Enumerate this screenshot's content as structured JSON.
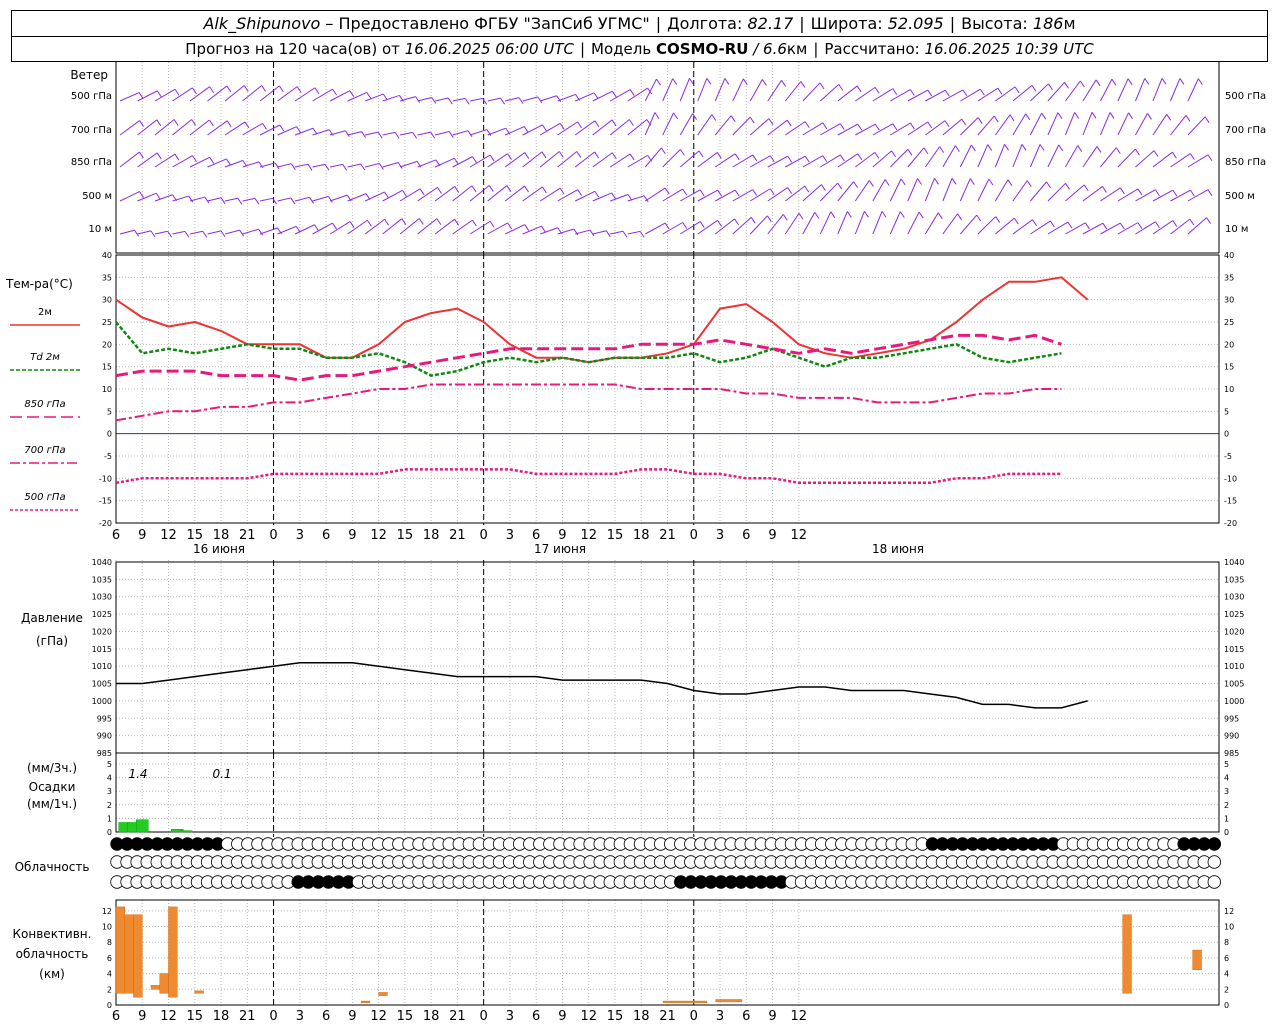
{
  "header": {
    "station": "Alk_Shipunovo",
    "provider": "– Предоставлено ФГБУ \"ЗапСиб УГМС\"",
    "lon_label": "Долгота:",
    "lon_value": "82.17",
    "lat_label": "Широта:",
    "lat_value": "52.095",
    "alt_label": "Высота:",
    "alt_value": "186",
    "alt_unit": "м",
    "forecast_label": "Прогноз на 120 часа(ов) от",
    "forecast_start": "16.06.2025 06:00 UTC",
    "model_label": "Модель",
    "model_name": "COSMO-RU",
    "model_res": "/ 6.6",
    "model_res_unit": "км",
    "calc_label": "Рассчитано:",
    "calc_time": "16.06.2025 10:39 UTC"
  },
  "time_axis": {
    "hour_ticks": [
      "6",
      "9",
      "12",
      "15",
      "18",
      "21",
      "0",
      "3",
      "6",
      "9",
      "12",
      "15",
      "18",
      "21",
      "0",
      "3",
      "6",
      "9",
      "12",
      "15",
      "18",
      "21",
      "0",
      "3",
      "6",
      "9",
      "12"
    ],
    "day_labels": [
      "16 июня",
      "17 июня",
      "18 июня"
    ]
  },
  "wind": {
    "title": "Ветер",
    "levels": [
      "500 гПа",
      "700 гПа",
      "850 гПа",
      "500 м",
      "10   м"
    ],
    "color": "#8a2be2"
  },
  "temperature": {
    "ylabel": "Тем-ра(°C)",
    "yticks": [
      "40",
      "35",
      "30",
      "25",
      "20",
      "15",
      "10",
      "5",
      "0",
      "-5",
      "-10",
      "-15",
      "-20"
    ],
    "legend": [
      {
        "label": "2м",
        "color": "#ee3333"
      },
      {
        "label": "Td  2м",
        "color": "#118811"
      },
      {
        "label": "850 гПа",
        "color": "#e8197d"
      },
      {
        "label": "700 гПа",
        "color": "#e8197d"
      },
      {
        "label": "500 гПа",
        "color": "#e8197d"
      }
    ]
  },
  "pressure": {
    "ylabel_1": "Давление",
    "ylabel_2": "(гПа)",
    "yticks": [
      "1040",
      "1035",
      "1030",
      "1025",
      "1020",
      "1015",
      "1010",
      "1005",
      "1000",
      "995",
      "990",
      "985"
    ]
  },
  "precip": {
    "ylabel_1": "(мм/3ч.)",
    "ylabel_2": "Осадки",
    "ylabel_3": "(мм/1ч.)",
    "yticks": [
      "5",
      "4",
      "3",
      "2",
      "1",
      "0"
    ],
    "annotations": [
      "1.4",
      "0.1"
    ],
    "color": "#22cc22"
  },
  "cloud": {
    "label": "Облачность"
  },
  "convective": {
    "ylabel_1": "Конвективн.",
    "ylabel_2": "облачность",
    "ylabel_3": "(км)",
    "yticks": [
      "12",
      "10",
      "8",
      "6",
      "4",
      "2",
      "0"
    ],
    "color": "#f08a30"
  },
  "chart_data": [
    {
      "type": "line",
      "title": "Тем-ра(°C)",
      "x_hours": [
        0,
        3,
        6,
        9,
        12,
        15,
        18,
        21,
        24,
        27,
        30,
        33,
        36,
        39,
        42,
        45,
        48,
        51,
        54,
        57,
        60,
        63,
        66,
        69,
        72,
        75,
        78,
        81,
        84,
        87,
        90,
        93,
        96,
        99,
        102,
        105,
        108,
        111,
        114,
        117,
        120,
        123,
        126
      ],
      "ylim": [
        -20,
        40
      ],
      "series": [
        {
          "name": "2м",
          "values": [
            30,
            26,
            24,
            25,
            23,
            20,
            20,
            20,
            17,
            17,
            20,
            25,
            27,
            28,
            25,
            20,
            17,
            17,
            16,
            17,
            17,
            18,
            20,
            28,
            29,
            25,
            20,
            18,
            17,
            18,
            19,
            21,
            25,
            30,
            34,
            34,
            35,
            30,
            null,
            null,
            null,
            null,
            null
          ]
        },
        {
          "name": "Td  2м",
          "values": [
            25,
            18,
            19,
            18,
            19,
            20,
            19,
            19,
            17,
            17,
            18,
            16,
            13,
            14,
            16,
            17,
            16,
            17,
            16,
            17,
            17,
            17,
            18,
            16,
            17,
            19,
            17,
            15,
            17,
            17,
            18,
            19,
            20,
            17,
            16,
            17,
            18,
            null,
            null,
            null,
            null,
            null,
            null
          ]
        },
        {
          "name": "850 гПа",
          "values": [
            13,
            14,
            14,
            14,
            13,
            13,
            13,
            12,
            13,
            13,
            14,
            15,
            16,
            17,
            18,
            19,
            19,
            19,
            19,
            19,
            20,
            20,
            20,
            21,
            20,
            19,
            18,
            19,
            18,
            19,
            20,
            21,
            22,
            22,
            21,
            22,
            20,
            null,
            null,
            null,
            null,
            null,
            null
          ]
        },
        {
          "name": "700 гПа",
          "values": [
            3,
            4,
            5,
            5,
            6,
            6,
            7,
            7,
            8,
            9,
            10,
            10,
            11,
            11,
            11,
            11,
            11,
            11,
            11,
            11,
            10,
            10,
            10,
            10,
            9,
            9,
            8,
            8,
            8,
            7,
            7,
            7,
            8,
            9,
            9,
            10,
            10,
            null,
            null,
            null,
            null,
            null,
            null
          ]
        },
        {
          "name": "500 гПа",
          "values": [
            -11,
            -10,
            -10,
            -10,
            -10,
            -10,
            -9,
            -9,
            -9,
            -9,
            -9,
            -8,
            -8,
            -8,
            -8,
            -8,
            -9,
            -9,
            -9,
            -9,
            -8,
            -8,
            -9,
            -9,
            -10,
            -10,
            -11,
            -11,
            -11,
            -11,
            -11,
            -11,
            -10,
            -10,
            -9,
            -9,
            -9,
            null,
            null,
            null,
            null,
            null,
            null
          ]
        }
      ]
    },
    {
      "type": "line",
      "title": "Давление (гПа)",
      "x_hours": [
        0,
        3,
        6,
        9,
        12,
        15,
        18,
        21,
        24,
        27,
        30,
        33,
        36,
        39,
        42,
        45,
        48,
        51,
        54,
        57,
        60,
        63,
        66,
        69,
        72,
        75,
        78,
        81,
        84,
        87,
        90,
        93,
        96,
        99,
        102,
        105,
        108,
        111
      ],
      "ylim": [
        985,
        1040
      ],
      "series": [
        {
          "name": "",
          "values": [
            1005,
            1005,
            1006,
            1007,
            1008,
            1009,
            1010,
            1011,
            1011,
            1011,
            1010,
            1009,
            1008,
            1007,
            1007,
            1007,
            1007,
            1006,
            1006,
            1006,
            1006,
            1005,
            1003,
            1002,
            1002,
            1003,
            1004,
            1004,
            1003,
            1003,
            1003,
            1002,
            1001,
            999,
            999,
            998,
            998,
            1000
          ]
        }
      ]
    },
    {
      "type": "bar",
      "title": "Осадки (мм/1ч.)",
      "x_hours": [
        1,
        2,
        3,
        7,
        8
      ],
      "values": [
        0.7,
        0.7,
        0.9,
        0.2,
        0.1
      ]
    },
    {
      "type": "bar",
      "title": "Конвективн. облачность (км)",
      "ylim": [
        0,
        13
      ],
      "bars": [
        {
          "x_hour": 0.5,
          "width_h": 1,
          "base": 1.5,
          "top": 12.5
        },
        {
          "x_hour": 1.5,
          "width_h": 1,
          "base": 1.5,
          "top": 11.5
        },
        {
          "x_hour": 2.5,
          "width_h": 1,
          "base": 1.0,
          "top": 11.5
        },
        {
          "x_hour": 4.5,
          "width_h": 1,
          "base": 2.0,
          "top": 2.5
        },
        {
          "x_hour": 5.5,
          "width_h": 1,
          "base": 1.5,
          "top": 4.0
        },
        {
          "x_hour": 6.5,
          "width_h": 1,
          "base": 1.0,
          "top": 12.5
        },
        {
          "x_hour": 9.5,
          "width_h": 1,
          "base": 1.5,
          "top": 1.8
        },
        {
          "x_hour": 28.5,
          "width_h": 1,
          "base": 0.3,
          "top": 0.5
        },
        {
          "x_hour": 30.5,
          "width_h": 1,
          "base": 1.2,
          "top": 1.6
        },
        {
          "x_hour": 65,
          "width_h": 5,
          "base": 0.3,
          "top": 0.5
        },
        {
          "x_hour": 70,
          "width_h": 3,
          "base": 0.4,
          "top": 0.7
        },
        {
          "x_hour": 115.5,
          "width_h": 1,
          "base": 1.5,
          "top": 11.5
        },
        {
          "x_hour": 123.5,
          "width_h": 1,
          "base": 4.5,
          "top": 7.0
        }
      ]
    }
  ]
}
